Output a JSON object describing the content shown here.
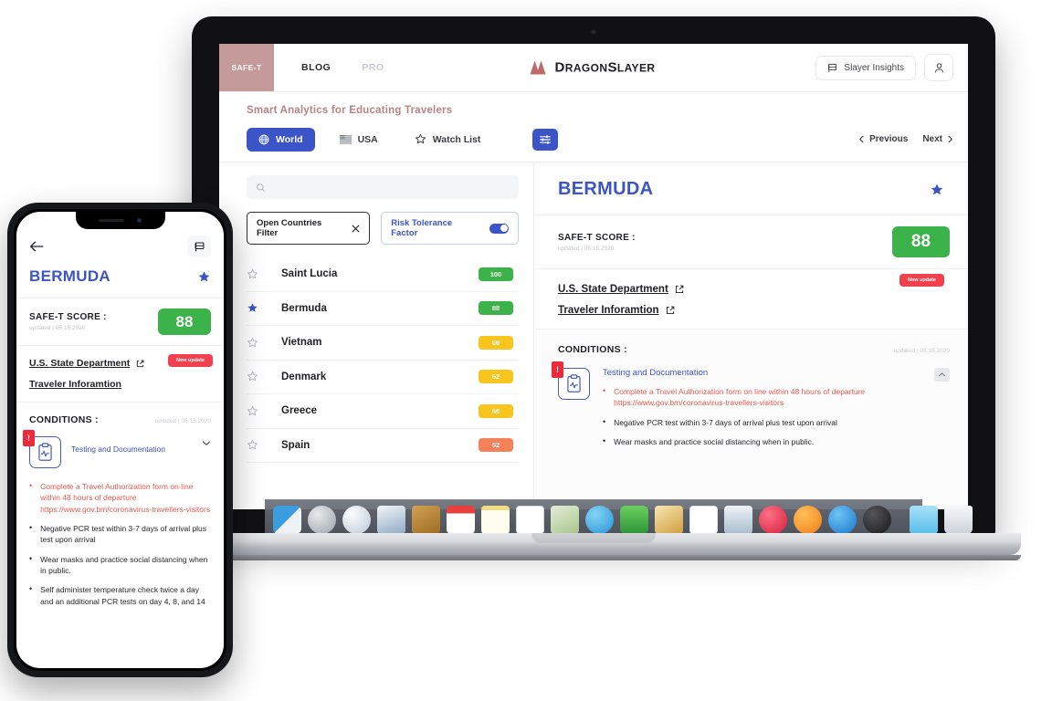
{
  "app": {
    "navbar": {
      "safet_tab": "SAFE-T",
      "links": [
        {
          "label": "BLOG",
          "muted": false
        },
        {
          "label": "PRO",
          "muted": true
        }
      ],
      "brand": "DragonSlayer",
      "brand_upper": "D",
      "insights_button": "Slayer Insights",
      "insights_icon": "flag-icon",
      "account_icon": "person-icon"
    },
    "tagline": "Smart Analytics for Educating Travelers",
    "tabs": [
      {
        "label": "World",
        "icon": "globe-icon",
        "active": true
      },
      {
        "label": "USA",
        "icon": "us-flag-icon",
        "active": false
      },
      {
        "label": "Watch List",
        "icon": "star-outline-icon",
        "active": false
      }
    ],
    "filter_icon": "sliders-icon",
    "pager": {
      "previous": "Previous",
      "next": "Next"
    },
    "search": {
      "value": "",
      "placeholder": "",
      "icon": "search-icon"
    },
    "chips": {
      "open_countries_filter": "Open Countries Filter",
      "clear_icon": "close-icon",
      "risk_tolerance_factor": "Risk Tolerance Factor",
      "toggle_on": true
    },
    "countries": [
      {
        "name": "Saint Lucia",
        "score": "100",
        "color": "#3cb34a",
        "starred": false
      },
      {
        "name": "Bermuda",
        "score": "88",
        "color": "#3cb34a",
        "starred": true
      },
      {
        "name": "Vietnam",
        "score": "68",
        "color": "#f7c51e",
        "starred": false
      },
      {
        "name": "Denmark",
        "score": "62",
        "color": "#f7c51e",
        "starred": false
      },
      {
        "name": "Greece",
        "score": "60",
        "color": "#f7c51e",
        "starred": false
      },
      {
        "name": "Spain",
        "score": "52",
        "color": "#f48159",
        "starred": false
      }
    ],
    "detail": {
      "country": "BERMUDA",
      "starred": true,
      "score_label": "SAFE-T SCORE :",
      "score_updated": "updated | 05.15.2020",
      "score_value": "88",
      "score_color": "#3cb34a",
      "links": [
        {
          "label": "U.S. State Department",
          "icon": "external-link-icon"
        },
        {
          "label": "Traveler Inforamtion",
          "icon": "external-link-icon"
        }
      ],
      "new_update_badge": "New update",
      "conditions_title": "CONDITIONS :",
      "conditions_updated": "updated | 05.15.2020",
      "condition_group": {
        "alert_mark": "!",
        "icon": "clipboard-health-icon",
        "title": "Testing and Documentation",
        "collapse_icon": "chevron-up-icon",
        "items": [
          {
            "text": "Complete a Travel Authorization form on line within 48 hours of departure https://www.gov.bm/coronavirus-travellers-visitors",
            "highlight": true
          },
          {
            "text": "Negative PCR test within 3-7 days of arrival plus test upon arrival",
            "highlight": false
          },
          {
            "text": "Wear masks and practice social distancing when in public.",
            "highlight": false
          }
        ]
      }
    }
  },
  "phone": {
    "back_icon": "arrow-left-icon",
    "flag_icon": "flag-icon",
    "country": "BERMUDA",
    "score_label": "SAFE-T SCORE :",
    "score_updated": "updated | 05.15.2020",
    "score_value": "88",
    "links": [
      {
        "label": "U.S. State Department",
        "icon": "external-link-icon"
      },
      {
        "label": "Traveler Inforamtion",
        "icon": ""
      }
    ],
    "new_update_badge": "New update",
    "conditions_title": "CONDITIONS :",
    "conditions_updated": "updated | 05.15.2020",
    "condition_group": {
      "alert_mark": "!",
      "icon": "clipboard-health-icon",
      "title": "Testing and Documentation",
      "expand_icon": "chevron-down-icon",
      "items": [
        {
          "text": "Complete a Travel Authorization form on line within 48 hours of departure https://www.gov.bm/coronavirus-travellers-visitors",
          "highlight": true
        },
        {
          "text": "Negative PCR test within 3-7 days of arrival plus test upon arrival",
          "highlight": false
        },
        {
          "text": "Wear masks and practice social distancing when in public.",
          "highlight": false
        },
        {
          "text": "Self administer temperature check twice a day and an additional PCR tests on day 4, 8, and 14",
          "highlight": false
        }
      ]
    }
  },
  "dock": {
    "items": [
      {
        "name": "finder-icon",
        "c1": "#3b9ddd",
        "c2": "#e9eef3"
      },
      {
        "name": "launchpad-icon",
        "c1": "#c9ced4",
        "c2": "#8e949c"
      },
      {
        "name": "safari-icon",
        "c1": "#eef3f7",
        "c2": "#c0ccd6"
      },
      {
        "name": "photos-icon",
        "c1": "#eef2f6",
        "c2": "#9fb4c8"
      },
      {
        "name": "contacts-icon",
        "c1": "#cf9a47",
        "c2": "#a87327"
      },
      {
        "name": "calendar-icon",
        "c1": "#ffffff",
        "c2": "#e8413c"
      },
      {
        "name": "notes-icon",
        "c1": "#fdf6cf",
        "c2": "#f3e38a"
      },
      {
        "name": "reminders-icon",
        "c1": "#ffffff",
        "c2": "#dfe3e8"
      },
      {
        "name": "maps-icon",
        "c1": "#dfe9d3",
        "c2": "#b6cf9a"
      },
      {
        "name": "messages-icon",
        "c1": "#69c7f0",
        "c2": "#2d9bdc"
      },
      {
        "name": "facetime-icon",
        "c1": "#61c358",
        "c2": "#2f9b3a"
      },
      {
        "name": "pages-icon",
        "c1": "#f3dfa6",
        "c2": "#d8a94a"
      },
      {
        "name": "numbers-icon",
        "c1": "#ffffff",
        "c2": "#e4e8ec"
      },
      {
        "name": "keynote-icon",
        "c1": "#e8eef4",
        "c2": "#9fb2c3"
      },
      {
        "name": "itunes-icon",
        "c1": "#f4566b",
        "c2": "#e02a44"
      },
      {
        "name": "ibooks-icon",
        "c1": "#fbb040",
        "c2": "#ef7f1e"
      },
      {
        "name": "app-store-icon",
        "c1": "#53b6f0",
        "c2": "#1f7fd0"
      },
      {
        "name": "system-preferences-icon",
        "c1": "#4c4c50",
        "c2": "#1d1d20"
      },
      {
        "name": "downloads-folder-icon",
        "c1": "#9edcf7",
        "c2": "#5fc0ea"
      },
      {
        "name": "trash-icon",
        "c1": "#f2f4f6",
        "c2": "#cfd5da"
      }
    ]
  }
}
